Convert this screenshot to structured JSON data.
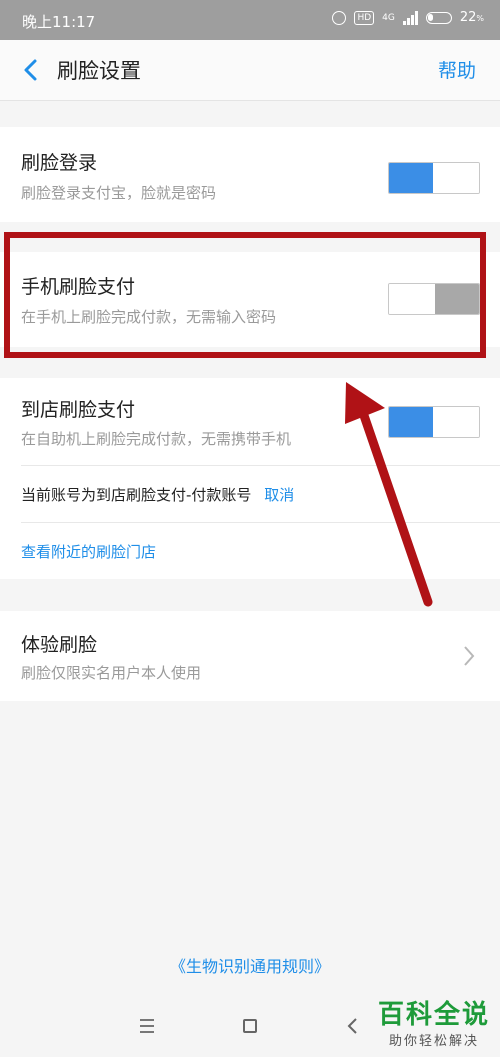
{
  "status_bar": {
    "time": "晚上11:17",
    "network": "4G",
    "hd": "HD",
    "battery": "22"
  },
  "nav": {
    "title": "刷脸设置",
    "help": "帮助"
  },
  "settings": [
    {
      "title": "刷脸登录",
      "subtitle": "刷脸登录支付宝，脸就是密码",
      "enabled": true
    },
    {
      "title": "手机刷脸支付",
      "subtitle": "在手机上刷脸完成付款，无需输入密码",
      "enabled": false
    },
    {
      "title": "到店刷脸支付",
      "subtitle": "在自助机上刷脸完成付款，无需携带手机",
      "enabled": true
    }
  ],
  "store_account": {
    "text": "当前账号为到店刷脸支付-付款账号",
    "cancel": "取消"
  },
  "nearby_stores": "查看附近的刷脸门店",
  "experience": {
    "title": "体验刷脸",
    "subtitle": "刷脸仅限实名用户本人使用"
  },
  "footer_link": "《生物识别通用规则》",
  "watermark": {
    "main": "百科全说",
    "sub": "助你轻松解决"
  },
  "colors": {
    "accent": "#1f8ee8",
    "toggle_on": "#3b8ee6",
    "highlight": "#b01216",
    "watermark": "#1e9b3a"
  }
}
